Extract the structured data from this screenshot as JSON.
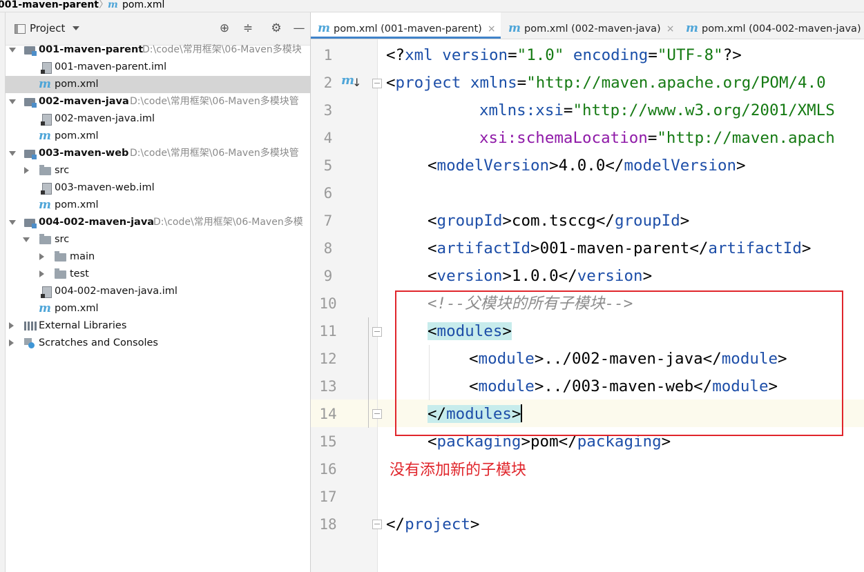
{
  "breadcrumb": {
    "project": "001-maven-parent",
    "separator": "〉",
    "file_icon": "m",
    "file": "pom.xml"
  },
  "project_panel": {
    "title": "Project",
    "buttons": [
      "locate-icon",
      "collapse-all-icon",
      "gear-icon",
      "minimize-icon"
    ],
    "tree": [
      {
        "label": "001-maven-parent",
        "path": "D:\\code\\常用框架\\06-Maven多模块",
        "icon": "module-icon",
        "expanded": true
      },
      {
        "label": "001-maven-parent.iml",
        "icon": "iml-file-icon"
      },
      {
        "label": "pom.xml",
        "icon": "maven-icon",
        "selected": true
      },
      {
        "label": "002-maven-java",
        "path": "D:\\code\\常用框架\\06-Maven多模块管",
        "icon": "module-icon",
        "expanded": true
      },
      {
        "label": "002-maven-java.iml",
        "icon": "iml-file-icon"
      },
      {
        "label": "pom.xml",
        "icon": "maven-icon"
      },
      {
        "label": "003-maven-web",
        "path": "D:\\code\\常用框架\\06-Maven多模块管",
        "icon": "module-icon",
        "expanded": true
      },
      {
        "label": "src",
        "icon": "folder-icon",
        "expanded": false
      },
      {
        "label": "003-maven-web.iml",
        "icon": "iml-file-icon"
      },
      {
        "label": "pom.xml",
        "icon": "maven-icon"
      },
      {
        "label": "004-002-maven-java",
        "path": "D:\\code\\常用框架\\06-Maven多模",
        "icon": "module-icon",
        "expanded": true
      },
      {
        "label": "src",
        "icon": "folder-icon",
        "expanded": true
      },
      {
        "label": "main",
        "icon": "folder-icon",
        "expanded": false
      },
      {
        "label": "test",
        "icon": "folder-icon",
        "expanded": false
      },
      {
        "label": "004-002-maven-java.iml",
        "icon": "iml-file-icon"
      },
      {
        "label": "pom.xml",
        "icon": "maven-icon"
      },
      {
        "label": "External Libraries",
        "icon": "library-icon",
        "expanded": false
      },
      {
        "label": "Scratches and Consoles",
        "icon": "scratches-icon",
        "expanded": false
      }
    ]
  },
  "editor": {
    "tabs": [
      {
        "label": "pom.xml (001-maven-parent)",
        "close": "×",
        "active": true
      },
      {
        "label": "pom.xml (002-maven-java)",
        "close": "×",
        "active": false
      },
      {
        "label": "pom.xml (004-002-maven-java)",
        "close": "",
        "active": false
      }
    ],
    "line_numbers": [
      "1",
      "2",
      "3",
      "4",
      "5",
      "6",
      "7",
      "8",
      "9",
      "10",
      "11",
      "12",
      "13",
      "14",
      "15",
      "16",
      "17",
      "18"
    ],
    "code": {
      "l1": {
        "open": "<?",
        "name": "xml",
        "a1": " version",
        "eq1": "=",
        "v1": "\"1.0\"",
        "a2": " encoding",
        "eq2": "=",
        "v2": "\"UTF-8\"",
        "close": "?>"
      },
      "l2": {
        "open": "<",
        "name": "project",
        "a1": " xmlns",
        "eq1": "=",
        "v1": "\"http://maven.apache.org/POM/4.0"
      },
      "l3": {
        "a1": "xmlns:xsi",
        "eq1": "=",
        "v1": "\"http://www.w3.org/2001/XMLS"
      },
      "l4": {
        "a1": "xsi:schemaLocation",
        "eq1": "=",
        "v1": "\"http://maven.apach"
      },
      "l5": {
        "open": "<",
        "name": "modelVersion",
        "gt": ">",
        "text": "4.0.0",
        "endopen": "</",
        "endname": "modelVersion",
        "endgt": ">"
      },
      "l7": {
        "open": "<",
        "name": "groupId",
        "gt": ">",
        "text": "com.tsccg",
        "endopen": "</",
        "endname": "groupId",
        "endgt": ">"
      },
      "l8": {
        "open": "<",
        "name": "artifactId",
        "gt": ">",
        "text": "001-maven-parent",
        "endopen": "</",
        "endname": "artifactId",
        "endgt": ">"
      },
      "l9": {
        "open": "<",
        "name": "version",
        "gt": ">",
        "text": "1.0.0",
        "endopen": "</",
        "endname": "version",
        "endgt": ">"
      },
      "l10": {
        "comment": "<!--父模块的所有子模块-->"
      },
      "l11": {
        "open": "<",
        "name": "modules",
        "gt": ">"
      },
      "l12": {
        "open": "<",
        "name": "module",
        "gt": ">",
        "text": "../002-maven-java",
        "endopen": "</",
        "endname": "module",
        "endgt": ">"
      },
      "l13": {
        "open": "<",
        "name": "module",
        "gt": ">",
        "text": "../003-maven-web",
        "endopen": "</",
        "endname": "module",
        "endgt": ">"
      },
      "l14": {
        "open": "</",
        "name": "modules",
        "gt": ">"
      },
      "l15": {
        "open": "<",
        "name": "packaging",
        "gt": ">",
        "text": "pom",
        "endopen": "</",
        "endname": "packaging",
        "endgt": ">"
      },
      "l18": {
        "open": "</",
        "name": "project",
        "gt": ">"
      }
    },
    "annotation": "没有添加新的子模块",
    "colors": {
      "tag": "#1d4ea8",
      "string": "#157a13",
      "xsi": "#8f1aa8",
      "comment": "#8c8c8c",
      "annotation": "#e0252b",
      "highlight": "#c7ecec"
    }
  }
}
